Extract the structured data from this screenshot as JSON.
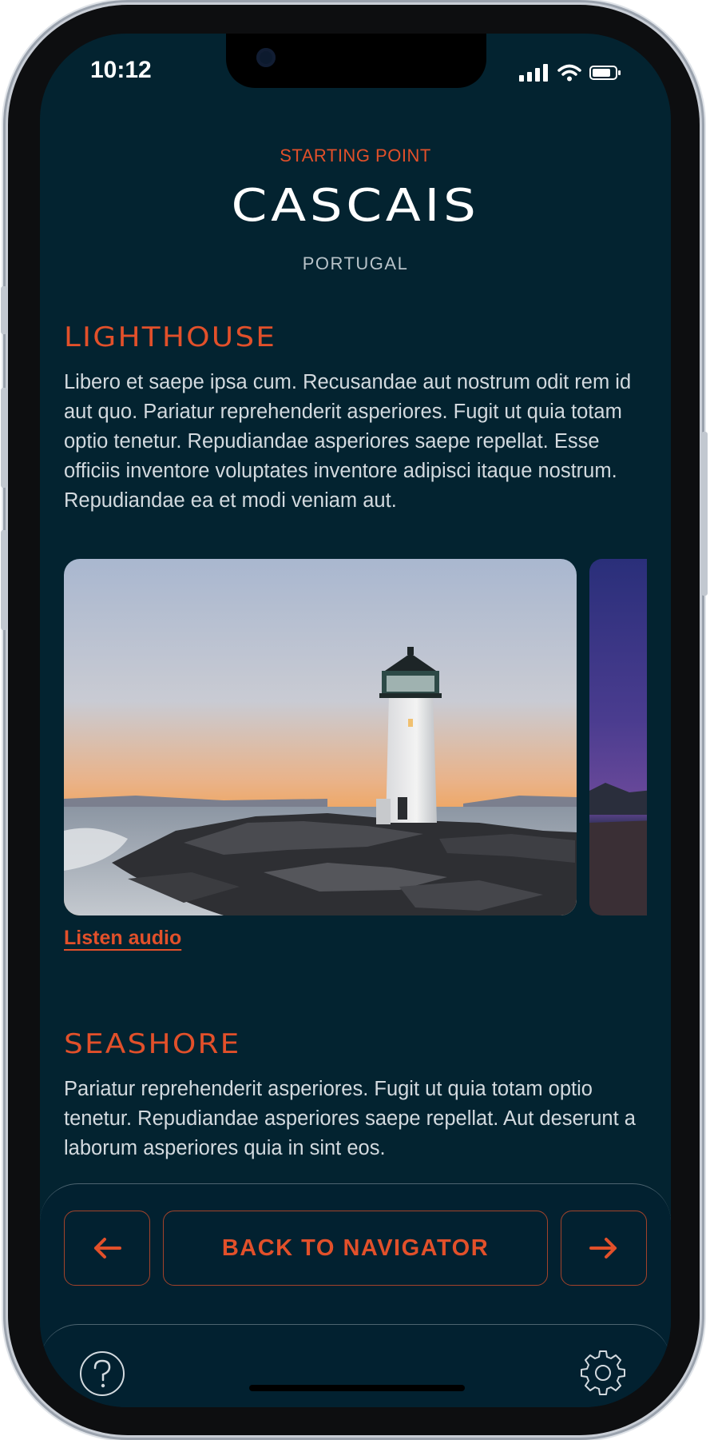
{
  "status": {
    "time": "10:12"
  },
  "header": {
    "subtitle": "STARTING POINT",
    "title": "CASCAIS",
    "country": "PORTUGAL"
  },
  "sections": [
    {
      "title": "LIGHTHOUSE",
      "body": "Libero et saepe ipsa cum. Recusandae aut nostrum odit rem id aut quo. Pariatur reprehenderit asperiores. Fugit ut quia totam optio tenetur. Repudiandae asperiores saepe repellat. Esse officiis inventore voluptates inventore adipisci itaque nostrum. Repudiandae ea et modi veniam aut.",
      "link": "Listen audio"
    },
    {
      "title": "SEASHORE",
      "body": "Pariatur reprehenderit asperiores. Fugit ut quia totam optio tenetur. Repudiandae asperiores saepe repellat. Aut deserunt a laborum asperiores quia in sint eos."
    }
  ],
  "navigation": {
    "back_label": "BACK TO NAVIGATOR",
    "prev_icon": "arrow-left-icon",
    "next_icon": "arrow-right-icon"
  },
  "toolbar": {
    "help_icon": "help-icon",
    "settings_icon": "gear-icon"
  },
  "colors": {
    "background": "#032330",
    "accent": "#e2502a",
    "text": "#d3dadf"
  }
}
